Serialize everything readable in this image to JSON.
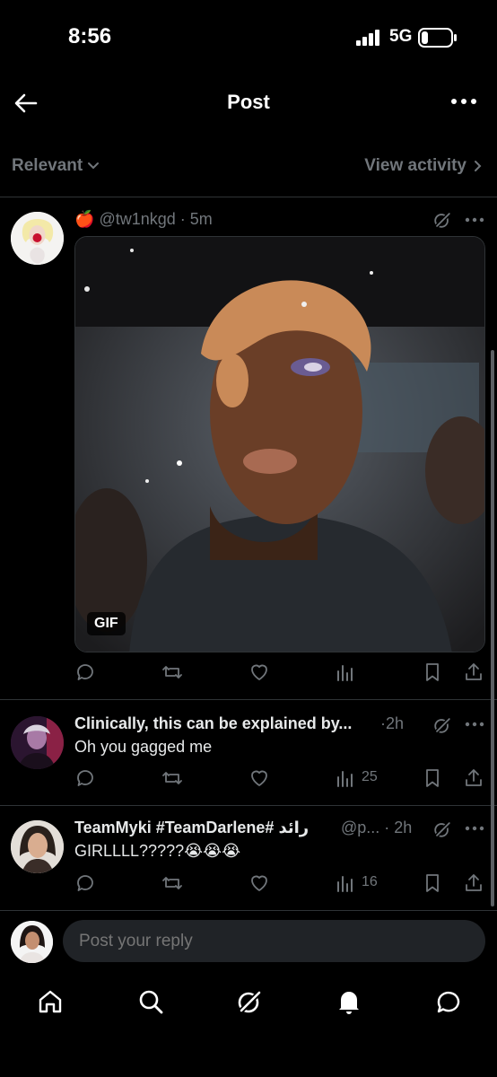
{
  "status_bar": {
    "time": "8:56",
    "network": "5G"
  },
  "header": {
    "title": "Post"
  },
  "filter": {
    "sort_label": "Relevant",
    "activity_label": "View activity"
  },
  "main_post": {
    "emoji": "🍎",
    "handle": "@tw1nkgd",
    "time": "5m",
    "media_badge": "GIF"
  },
  "replies": [
    {
      "name": "Clinically, this can be explained by...",
      "time": "2h",
      "text": "Oh you gagged me",
      "views": "25"
    },
    {
      "name": "TeamMyki #TeamDarlene# رائد",
      "handle": "@p...",
      "time": "2h",
      "text": "GIRLLLL?????😭😭😭",
      "views": "16"
    }
  ],
  "compose": {
    "placeholder": "Post your reply"
  },
  "icons": {
    "back": "arrow-left-icon",
    "more": "more-horizontal-icon",
    "reply": "reply-icon",
    "repost": "repost-icon",
    "like": "heart-icon",
    "views": "views-icon",
    "bookmark": "bookmark-icon",
    "share": "share-icon",
    "grok": "grok-icon",
    "home": "home-icon",
    "search": "search-icon",
    "notifications": "bell-icon",
    "messages": "messages-icon"
  },
  "colors": {
    "background": "#000000",
    "muted": "#71767b",
    "text": "#e7e9ea",
    "divider": "#2f3336"
  }
}
